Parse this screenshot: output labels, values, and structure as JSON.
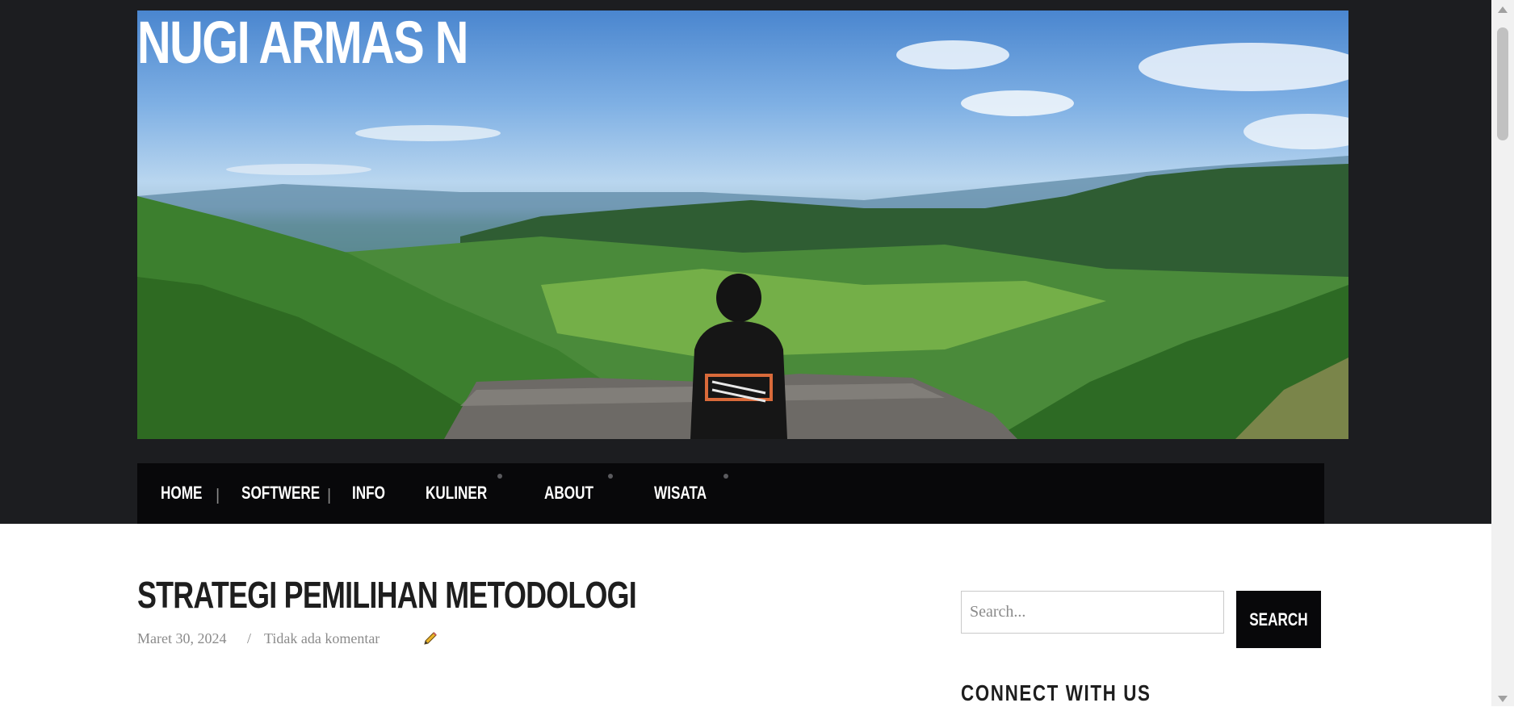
{
  "site": {
    "title": "NUGI ARMAS N"
  },
  "nav": {
    "items": [
      {
        "label": "HOME"
      },
      {
        "label": "SOFTWERE"
      },
      {
        "label": "INFO"
      },
      {
        "label": "KULINER"
      },
      {
        "label": "ABOUT"
      },
      {
        "label": "WISATA"
      }
    ],
    "separator": "|"
  },
  "post": {
    "title": "STRATEGI PEMILIHAN METODOLOGI",
    "date": "Maret 30, 2024",
    "meta_separator": "/",
    "comments": "Tidak ada komentar"
  },
  "sidebar": {
    "search": {
      "placeholder": "Search...",
      "button_label": "SEARCH"
    },
    "connect_title": "CONNECT WITH US"
  },
  "colors": {
    "header_bg": "#1c1d20",
    "navbar_bg": "#08080a",
    "button_bg": "#08080a",
    "title_text": "#1e1e1e",
    "meta_text": "#8b8b8b"
  },
  "icons": {
    "edit": "pencil-icon"
  }
}
